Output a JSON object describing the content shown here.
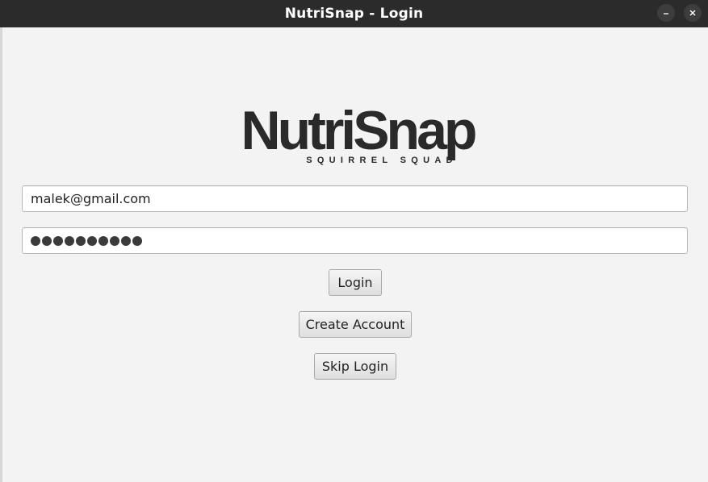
{
  "window": {
    "title": "NutriSnap - Login",
    "minimize_icon": "minimize-icon",
    "close_icon": "close-icon"
  },
  "logo": {
    "main": "NutriSnap",
    "sub": "SQUIRREL SQUAD"
  },
  "form": {
    "email_value": "malek@gmail.com",
    "password_masked": "●●●●●●●●●●",
    "password_length": 10
  },
  "buttons": {
    "login": "Login",
    "create_account": "Create Account",
    "skip_login": "Skip Login"
  },
  "colors": {
    "titlebar": "#2b2b2b",
    "background": "#f3f3f3",
    "logo": "#2a2a2a"
  }
}
